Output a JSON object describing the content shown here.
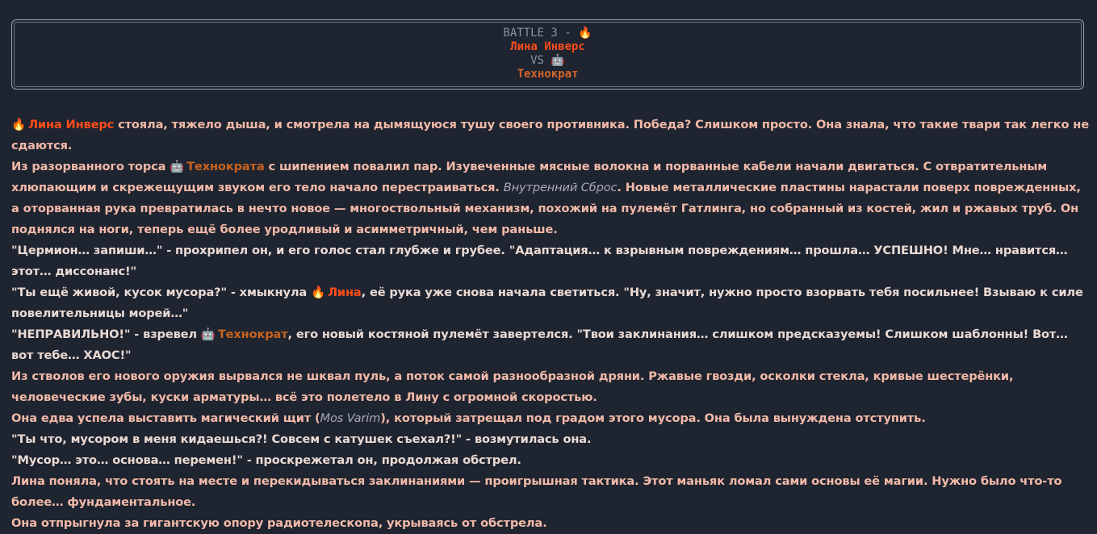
{
  "header": {
    "title": "BATTLE 3 -",
    "fighter1_icon": "fire-icon",
    "fighter1": "Лина Инверс",
    "vs": "VS",
    "fighter2_icon": "robot-icon",
    "fighter2": "Технократ"
  },
  "story": {
    "p1": {
      "icon": "🔥",
      "name": "Лина Инверс",
      "text": " стояла, тяжело дыша, и смотрела на дымящуюся тушу своего противника. Победа? Слишком просто. Она знала, что такие твари так легко не сдаются."
    },
    "p2": {
      "a": "Из разорванного торса ",
      "icon": "🤖",
      "name": "Технократа",
      "b": " с шипением повалил пар. Изувеченные мясные волокна и порванные кабели начали двигаться. С отвратительным хлюпающим и скрежещущим звуком его тело начало перестраиваться. ",
      "spell": "Внутренний Сброс",
      "c": ". Новые металлические пластины нарастали поверх поврежденных, а оторванная рука превратилась в нечто новое — многоствольный механизм, похожий на пулемёт Гатлинга, но собранный из костей, жил и ржавых труб. Он поднялся на ноги, теперь ещё более уродливый и асимметричный, чем раньше."
    },
    "p3": "\"Цермион… запиши…\" - прохрипел он, и его голос стал глубже и грубее. \"Адаптация… к взрывным повреждениям… прошла… УСПЕШНО! Мне… нравится… этот… диссонанс!\"",
    "p4": {
      "a": "\"Ты ещё живой, кусок мусора?\" - хмыкнула ",
      "icon": "🔥",
      "name": "Лина",
      "b": ", её рука уже снова начала светиться. \"Ну, значит, нужно просто взорвать тебя посильнее! Взываю к силе повелительницы морей…\""
    },
    "p5": {
      "a": "\"НЕПРАВИЛЬНО!\" - взревел ",
      "icon": "🤖",
      "name": "Технократ",
      "b": ", его новый костяной пулемёт завертелся. \"Твои заклинания… слишком предсказуемы! Слишком шаблонны! Вот… вот тебе… ХАОС!\""
    },
    "p6": "Из стволов его нового оружия вырвался не шквал пуль, а поток самой разнообразной дряни. Ржавые гвозди, осколки стекла, кривые шестерёнки, человеческие зубы, куски арматуры… всё это полетело в Лину с огромной скоростью.",
    "p7": {
      "a": "Она едва успела выставить магический щит (",
      "spell": "Mos Varim",
      "b": "), который затрещал под градом этого мусора. Она была вынуждена отступить."
    },
    "p8": "\"Ты что, мусором в меня кидаешься?! Совсем с катушек съехал?!\" - возмутилась она.",
    "p9": "\"Мусор… это… основа… перемен!\" - проскрежетал он, продолжая обстрел.",
    "p10": "Лина поняла, что стоять на месте и перекидываться заклинаниями — проигрышная тактика. Этот маньяк ломал сами основы её магии. Нужно было что-то более… фундаментальное.",
    "p11": "Она отпрыгнула за гигантскую опору радиотелескопа, укрываясь от обстрела."
  }
}
